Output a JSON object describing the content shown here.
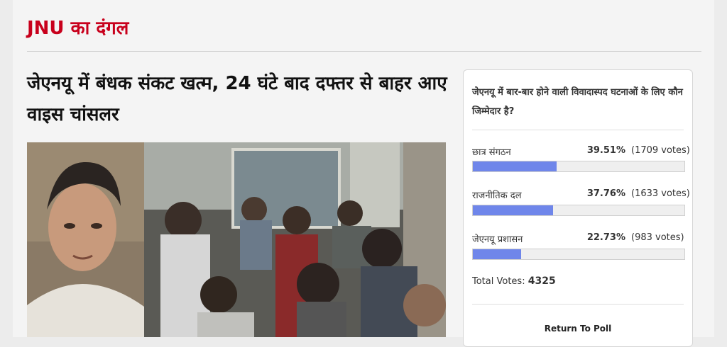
{
  "section": {
    "title": "JNU का दंगल"
  },
  "article": {
    "headline": "जेएनयू में बंधक संकट खत्म, 24 घंटे बाद दफ्तर से बाहर आए वाइस चांसलर"
  },
  "poll": {
    "question": "जेएनयू में बार-बार होने वाली विवादास्पद घटनाओं के लिए कौन जिम्मेदार है?",
    "answers": [
      {
        "label": "छात्र संगठन",
        "percent": "39.51%",
        "votes": "(1709 votes)",
        "fraction": 0.3951
      },
      {
        "label": "राजनीतिक दल",
        "percent": "37.76%",
        "votes": "(1633 votes)",
        "fraction": 0.3776
      },
      {
        "label": "जेएनयू प्रशासन",
        "percent": "22.73%",
        "votes": "(983 votes)",
        "fraction": 0.2273
      }
    ],
    "total_label": "Total Votes:",
    "total_value": "4325",
    "return_label": "Return To Poll",
    "bar_color": "#6f86ea"
  },
  "colors": {
    "section_title": "#c8001c"
  }
}
